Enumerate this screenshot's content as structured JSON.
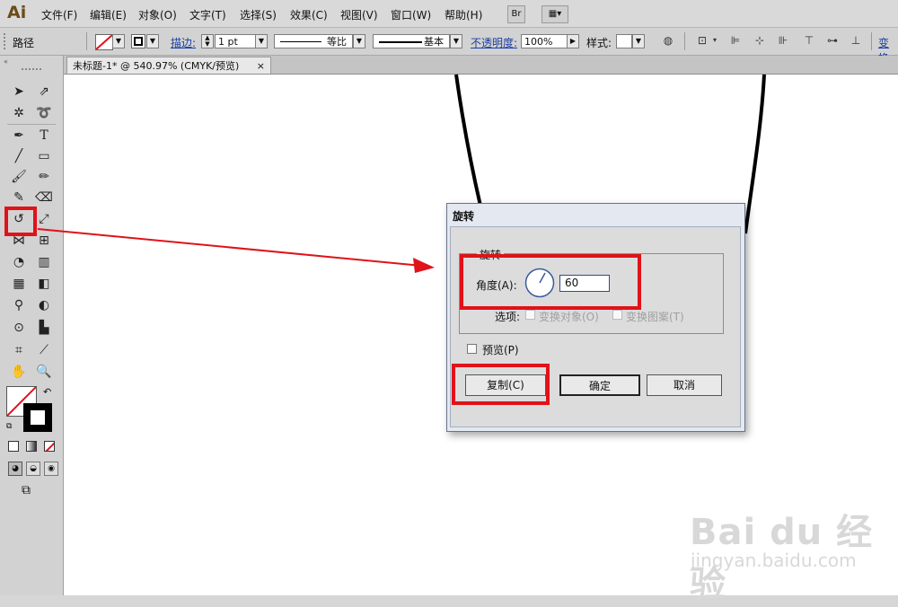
{
  "app": {
    "logo": "Ai"
  },
  "menubar": {
    "items": [
      "文件(F)",
      "编辑(E)",
      "对象(O)",
      "文字(T)",
      "选择(S)",
      "效果(C)",
      "视图(V)",
      "窗口(W)",
      "帮助(H)"
    ],
    "bridge_label": "Br"
  },
  "controlbar": {
    "selection_label": "路径",
    "stroke_label": "描边:",
    "stroke_weight": "1 pt",
    "profile_label": "等比",
    "brush_label": "基本",
    "opacity_label": "不透明度:",
    "opacity_value": "100%",
    "style_label": "样式:",
    "transform_label": "变换"
  },
  "document": {
    "tab_title": "未标题-1* @ 540.97% (CMYK/预览)",
    "tab_close": "×"
  },
  "dialog": {
    "title": "旋转",
    "group_label": "旋转",
    "angle_label": "角度(A):",
    "angle_value": "60",
    "options_label": "选项:",
    "transform_objects": "变换对象(O)",
    "transform_patterns": "变换图案(T)",
    "preview_label": "预览(P)",
    "copy_button": "复制(C)",
    "ok_button": "确定",
    "cancel_button": "取消"
  },
  "watermark": {
    "brand": "Bai du 经验",
    "url": "jingyan.baidu.com"
  },
  "annotation_color": "#e0121a"
}
